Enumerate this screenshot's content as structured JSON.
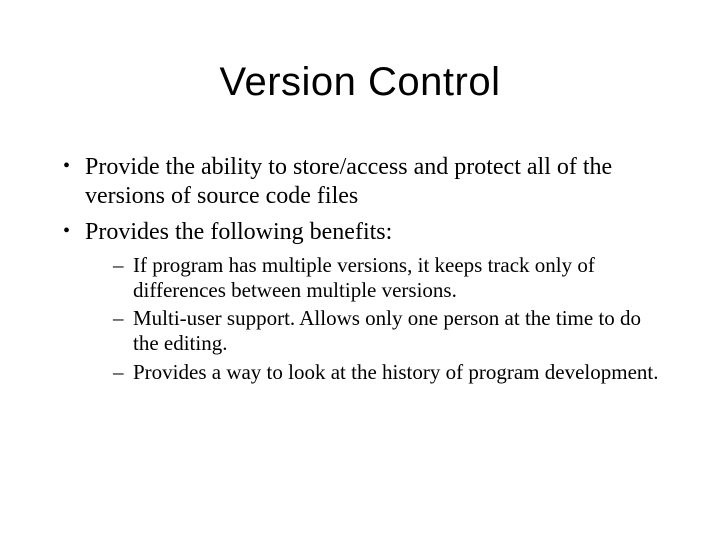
{
  "title": "Version Control",
  "bullets": [
    {
      "text": "Provide the ability to store/access and protect all of the versions of source code files",
      "sub": []
    },
    {
      "text": "Provides the following benefits:",
      "sub": [
        "If program has multiple versions, it keeps track only of differences between multiple versions.",
        "Multi-user support.  Allows only one person at the time to do the editing.",
        "Provides a way to look at the history of program development."
      ]
    }
  ]
}
